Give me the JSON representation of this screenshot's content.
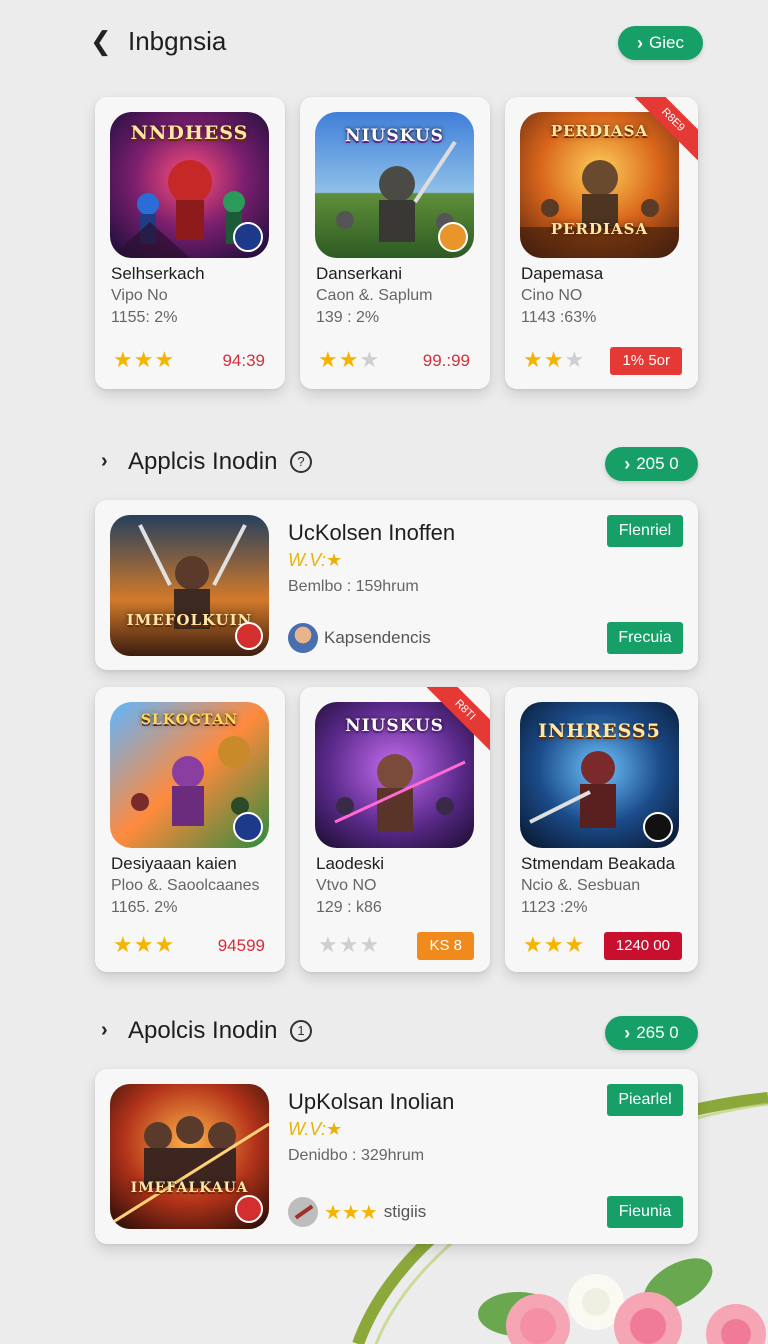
{
  "header": {
    "back_icon": "chevron-left-icon",
    "title": "Inbgnsia",
    "action_label": "Giec"
  },
  "top_grid": [
    {
      "name": "Selhserkach",
      "sub": "Vipo No",
      "num": "1155: 2%",
      "stars": 3,
      "stars_total": 3,
      "price": "94:39",
      "thumb_text": "NNDHESS",
      "ribbon": ""
    },
    {
      "name": "Danserkani",
      "sub": "Caon &. Saplum",
      "num": "139 : 2%",
      "stars": 2,
      "stars_total": 3,
      "price": "99.:99",
      "thumb_text": "NIUSKUS",
      "ribbon": ""
    },
    {
      "name": "Dapemasa",
      "sub": "Cino NO",
      "num": "1143 :63%",
      "stars": 2,
      "stars_total": 3,
      "price": "1% 5or",
      "thumb_text": "PERDIASA",
      "ribbon": "R8E9"
    }
  ],
  "section1": {
    "title": "Applcis Inodin",
    "info": "?",
    "action_label": "205 0"
  },
  "featured1": {
    "title": "UcKolsen Inoffen",
    "rating_text": "W.V:★",
    "meta": "Bemlbo : 159hrum",
    "developer": "Kapsendencis",
    "btn_top": "Flenriel",
    "btn_bottom": "Frecuia",
    "thumb_text": "IMEFOLKUIN"
  },
  "mid_grid": [
    {
      "name": "Desiyaaan kaien",
      "sub": "Ploo &. Saoolcaanes",
      "num": "1165. 2%",
      "stars": 3,
      "stars_total": 3,
      "price": "94599",
      "thumb_text": "SLKOGTAN",
      "ribbon": ""
    },
    {
      "name": "Laodeski",
      "sub": "Vtvo NO",
      "num": "129 : k86",
      "stars": 0,
      "stars_total": 3,
      "price": "KS 8",
      "thumb_text": "NIUSKUS",
      "ribbon": "R8TI"
    },
    {
      "name": "Stmendam Beakada",
      "sub": "Ncio &. Sesbuan",
      "num": "1123 :2%",
      "stars": 3,
      "stars_total": 3,
      "price": "1240 00",
      "thumb_text": "INHRESS5",
      "ribbon": ""
    }
  ],
  "section2": {
    "title": "Apolcis Inodin",
    "info": "1",
    "action_label": "265 0"
  },
  "featured2": {
    "title": "UpKolsan Inolian",
    "rating_text": "W.V:★",
    "meta": "Denidbo : 329hrum",
    "developer": "stigiis",
    "btn_top": "Piearlel",
    "btn_bottom": "Fieunia",
    "thumb_text": "IMEFALKAUA"
  },
  "colors": {
    "accent": "#16a068",
    "price": "#d32f3c",
    "star": "#f4b400",
    "tag_red": "#e53935",
    "tag_orange": "#f08a1c",
    "tag_crimson": "#c8102e"
  }
}
